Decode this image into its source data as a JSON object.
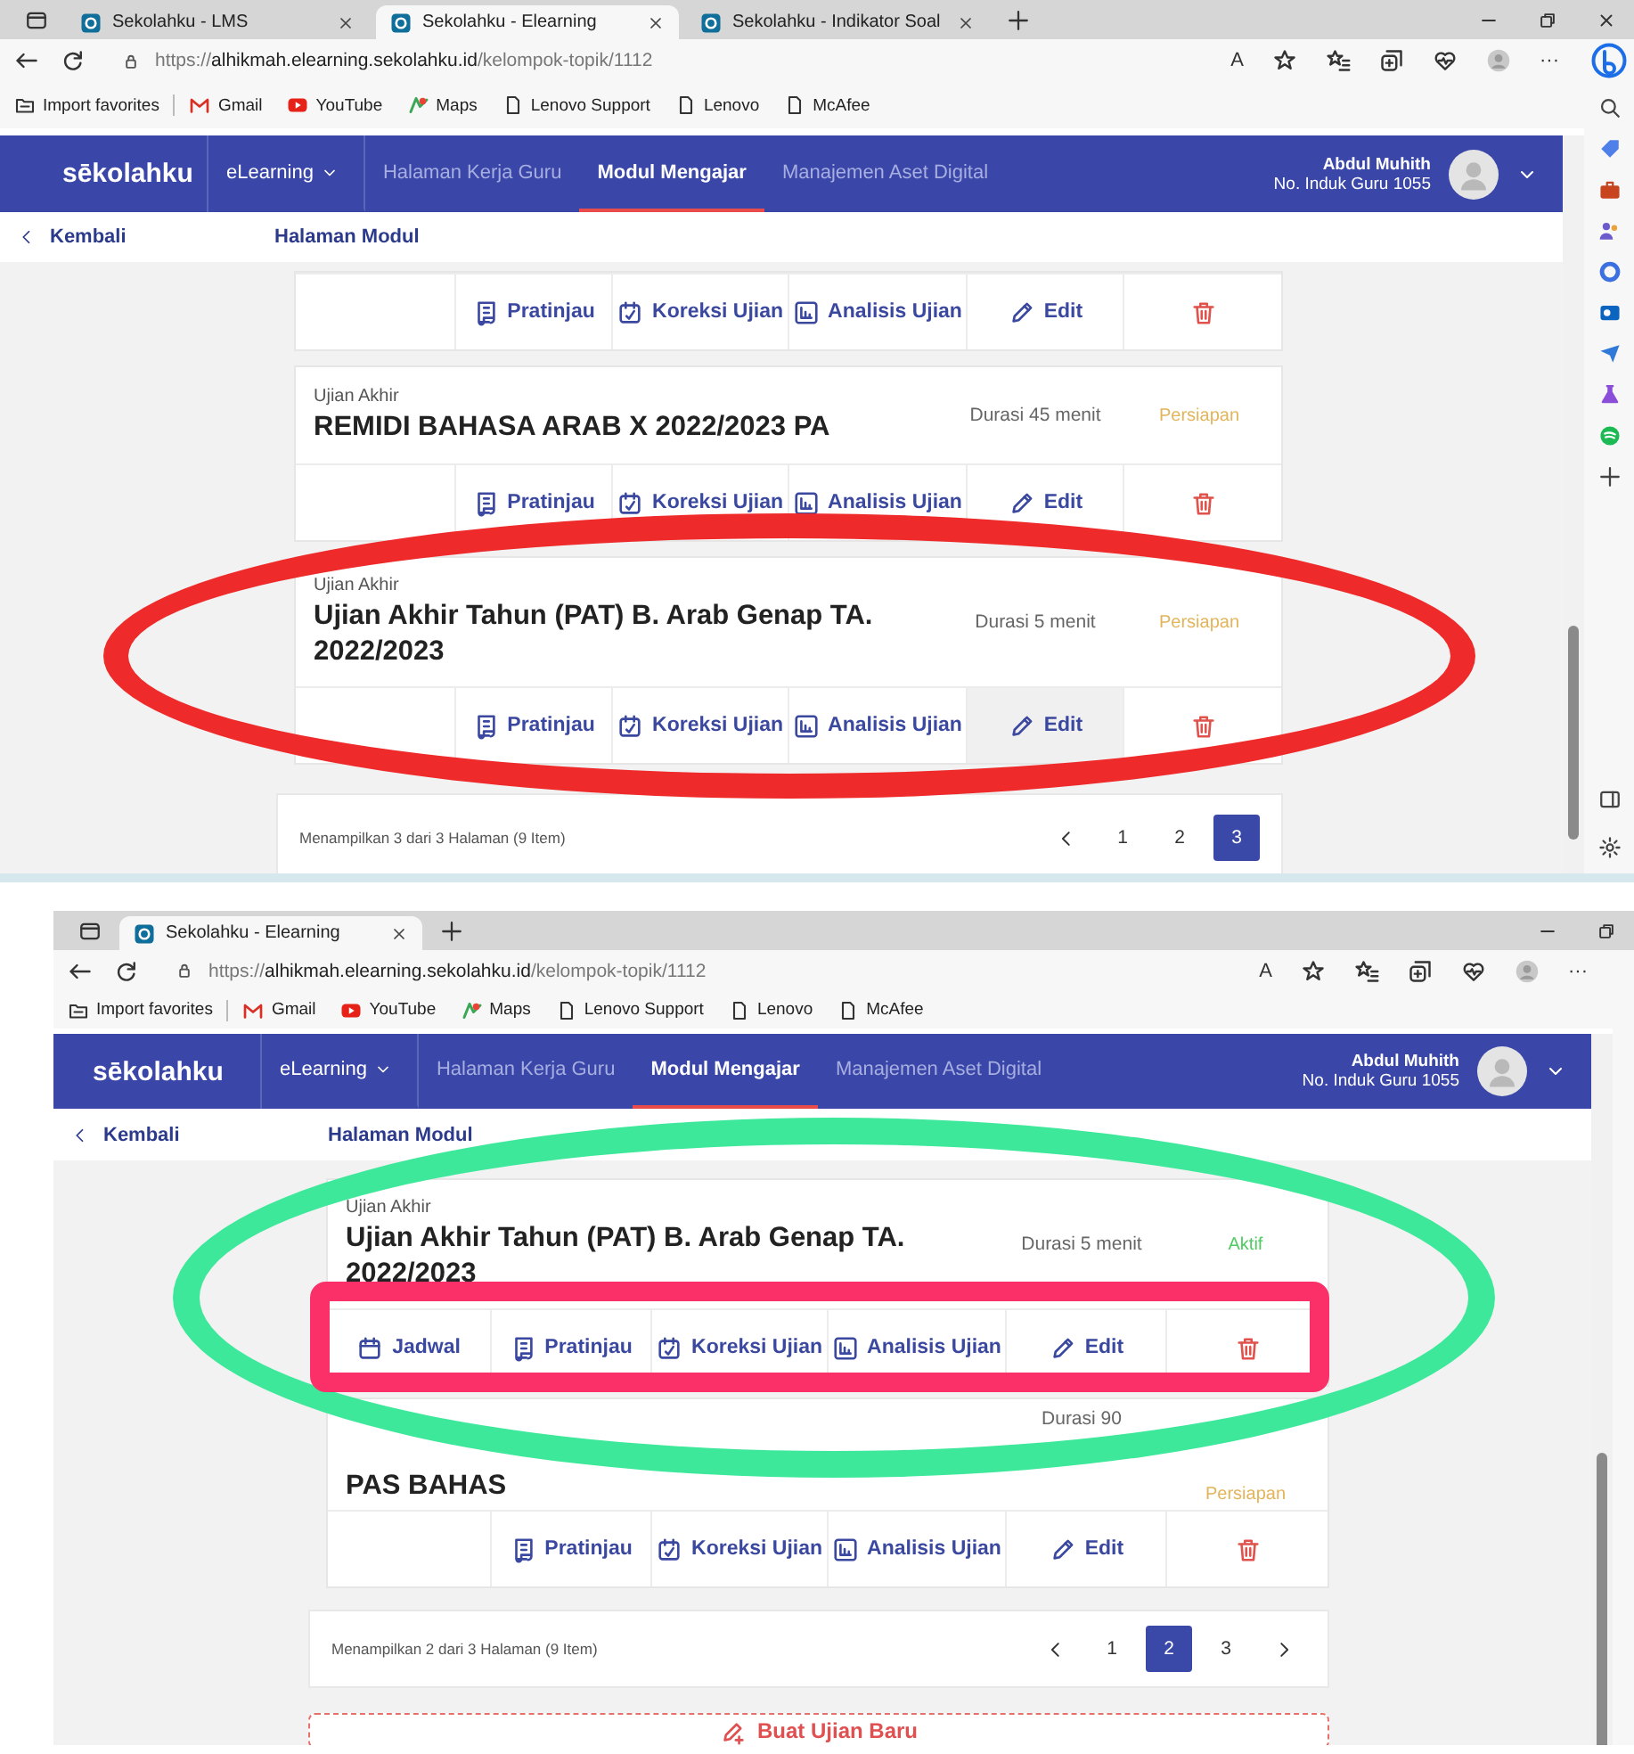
{
  "screenshots": [
    {
      "browser": {
        "tabs": [
          {
            "title": "Sekolahku - LMS",
            "selected": false
          },
          {
            "title": "Sekolahku - Elearning",
            "selected": true
          },
          {
            "title": "Sekolahku - Indikator Soal",
            "selected": false
          }
        ],
        "window_controls": [
          {
            "kind": "minimize"
          },
          {
            "kind": "restore"
          },
          {
            "kind": "close"
          }
        ],
        "url": {
          "scheme": "https://",
          "host": "alhikmah.elearning.sekolahku.id",
          "path": "/kelompok-topik/1112"
        },
        "toolbar": [
          {
            "kind": "read",
            "label": "A"
          },
          {
            "kind": "star"
          },
          {
            "kind": "favorites"
          },
          {
            "kind": "collections"
          },
          {
            "kind": "health"
          },
          {
            "kind": "profile"
          },
          {
            "kind": "more",
            "label": "···"
          }
        ],
        "favorites": [
          {
            "kind": "import",
            "label": "Import favorites"
          },
          {
            "kind": "gmail",
            "label": "Gmail"
          },
          {
            "kind": "youtube",
            "label": "YouTube"
          },
          {
            "kind": "maps",
            "label": "Maps"
          },
          {
            "kind": "page",
            "label": "Lenovo Support"
          },
          {
            "kind": "page",
            "label": "Lenovo"
          },
          {
            "kind": "page",
            "label": "McAfee"
          }
        ],
        "sidebar": {
          "kind": "full"
        }
      },
      "app": {
        "logo": "sēkolahku",
        "nav": [
          {
            "kind": "dropdown",
            "label": "eLearning",
            "selected": false
          },
          {
            "kind": "link",
            "label": "Halaman Kerja Guru",
            "selected": false
          },
          {
            "kind": "link",
            "label": "Modul Mengajar",
            "selected": true
          },
          {
            "kind": "link",
            "label": "Manajemen Aset Digital",
            "selected": false
          }
        ],
        "user": {
          "name": "Abdul Muhith",
          "id": "No. Induk Guru 1055"
        },
        "back": "Kembali",
        "breadcrumb": "Halaman Modul",
        "exams": [
          {
            "actions": [
              {
                "kind": "empty",
                "hovered": false
              },
              {
                "kind": "preview",
                "label": "Pratinjau",
                "hovered": false
              },
              {
                "kind": "grading",
                "label": "Koreksi Ujian",
                "hovered": false
              },
              {
                "kind": "analysis",
                "label": "Analisis Ujian",
                "hovered": false
              },
              {
                "kind": "edit",
                "label": "Edit",
                "hovered": false
              },
              {
                "kind": "delete",
                "hovered": false
              }
            ]
          },
          {
            "category": "Ujian Akhir",
            "title": "REMIDI BAHASA ARAB X 2022/2023 PA",
            "duration": "Durasi 45 menit",
            "status": {
              "kind": "preparing",
              "label": "Persiapan"
            },
            "actions": [
              {
                "kind": "empty",
                "hovered": false
              },
              {
                "kind": "preview",
                "label": "Pratinjau",
                "hovered": false
              },
              {
                "kind": "grading",
                "label": "Koreksi Ujian",
                "hovered": false
              },
              {
                "kind": "analysis",
                "label": "Analisis Ujian",
                "hovered": false
              },
              {
                "kind": "edit",
                "label": "Edit",
                "hovered": false
              },
              {
                "kind": "delete",
                "hovered": false
              }
            ]
          },
          {
            "category": "Ujian Akhir",
            "title": "Ujian Akhir Tahun (PAT) B. Arab Genap TA. 2022/2023",
            "duration": "Durasi 5 menit",
            "status": {
              "kind": "preparing",
              "label": "Persiapan"
            },
            "actions": [
              {
                "kind": "empty",
                "hovered": false
              },
              {
                "kind": "preview",
                "label": "Pratinjau",
                "hovered": false
              },
              {
                "kind": "grading",
                "label": "Koreksi Ujian",
                "hovered": false
              },
              {
                "kind": "analysis",
                "label": "Analisis Ujian",
                "hovered": false
              },
              {
                "kind": "edit",
                "label": "Edit",
                "hovered": true
              },
              {
                "kind": "delete",
                "hovered": false
              }
            ]
          }
        ],
        "pagination": {
          "summary": "Menampilkan 3 dari 3 Halaman (9 Item)",
          "prev": true,
          "next": false,
          "pages": [
            {
              "label": "1",
              "selected": false
            },
            {
              "label": "2",
              "selected": false
            },
            {
              "label": "3",
              "selected": true
            }
          ]
        }
      },
      "annotations": [
        {
          "kind": "ellipse",
          "color": "#ee2a2a"
        }
      ]
    },
    {
      "browser": {
        "tabs": [
          {
            "title": "Sekolahku - Elearning",
            "selected": true
          }
        ],
        "window_controls": [
          {
            "kind": "minimize"
          },
          {
            "kind": "restore"
          }
        ],
        "url": {
          "scheme": "https://",
          "host": "alhikmah.elearning.sekolahku.id",
          "path": "/kelompok-topik/1112"
        },
        "toolbar": [
          {
            "kind": "read",
            "label": "A"
          },
          {
            "kind": "star"
          },
          {
            "kind": "favorites"
          },
          {
            "kind": "collections"
          },
          {
            "kind": "health"
          },
          {
            "kind": "profile"
          },
          {
            "kind": "more",
            "label": "···"
          }
        ],
        "favorites": [
          {
            "kind": "import",
            "label": "Import favorites"
          },
          {
            "kind": "gmail",
            "label": "Gmail"
          },
          {
            "kind": "youtube",
            "label": "YouTube"
          },
          {
            "kind": "maps",
            "label": "Maps"
          },
          {
            "kind": "page",
            "label": "Lenovo Support"
          },
          {
            "kind": "page",
            "label": "Lenovo"
          },
          {
            "kind": "page",
            "label": "McAfee"
          }
        ],
        "sidebar": {
          "kind": "partial"
        }
      },
      "app": {
        "logo": "sēkolahku",
        "nav": [
          {
            "kind": "dropdown",
            "label": "eLearning",
            "selected": false
          },
          {
            "kind": "link",
            "label": "Halaman Kerja Guru",
            "selected": false
          },
          {
            "kind": "link",
            "label": "Modul Mengajar",
            "selected": true
          },
          {
            "kind": "link",
            "label": "Manajemen Aset Digital",
            "selected": false
          }
        ],
        "user": {
          "name": "Abdul Muhith",
          "id": "No. Induk Guru 1055"
        },
        "back": "Kembali",
        "breadcrumb": "Halaman Modul",
        "exams": [
          {
            "category": "Ujian Akhir",
            "title": "Ujian Akhir Tahun (PAT) B. Arab Genap TA. 2022/2023",
            "duration": "Durasi 5 menit",
            "status": {
              "kind": "active",
              "label": "Aktif"
            },
            "actions": [
              {
                "kind": "schedule",
                "label": "Jadwal",
                "hovered": false
              },
              {
                "kind": "preview",
                "label": "Pratinjau",
                "hovered": false
              },
              {
                "kind": "grading",
                "label": "Koreksi Ujian",
                "hovered": false
              },
              {
                "kind": "analysis",
                "label": "Analisis Ujian",
                "hovered": false
              },
              {
                "kind": "edit",
                "label": "Edit",
                "hovered": false
              },
              {
                "kind": "delete",
                "hovered": false
              }
            ]
          },
          {
            "title": "PAS BAHAS",
            "duration": "Durasi 90",
            "status": {
              "kind": "preparing",
              "label": "Persiapan"
            },
            "actions": [
              {
                "kind": "empty",
                "hovered": false
              },
              {
                "kind": "preview",
                "label": "Pratinjau",
                "hovered": false
              },
              {
                "kind": "grading",
                "label": "Koreksi Ujian",
                "hovered": false
              },
              {
                "kind": "analysis",
                "label": "Analisis Ujian",
                "hovered": false
              },
              {
                "kind": "edit",
                "label": "Edit",
                "hovered": false
              },
              {
                "kind": "delete",
                "hovered": false
              }
            ]
          }
        ],
        "pagination": {
          "summary": "Menampilkan 2 dari 3 Halaman (9 Item)",
          "prev": true,
          "next": true,
          "pages": [
            {
              "label": "1",
              "selected": false
            },
            {
              "label": "2",
              "selected": true
            },
            {
              "label": "3",
              "selected": false
            }
          ]
        },
        "create_button": "Buat Ujian Baru"
      },
      "annotations": [
        {
          "kind": "ellipse",
          "color": "#3ee89b"
        },
        {
          "kind": "frame",
          "color": "#fb3069"
        }
      ]
    }
  ]
}
